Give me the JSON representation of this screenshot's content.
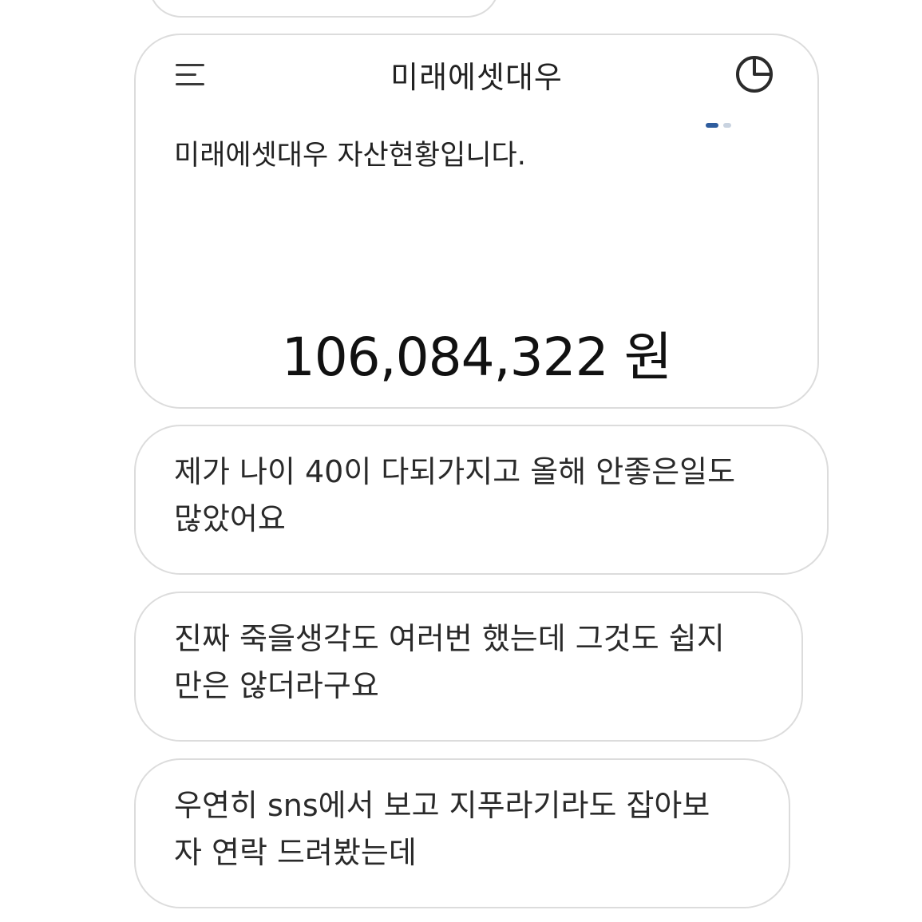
{
  "asset_card": {
    "title": "미래에셋대우",
    "subtitle": "미래에셋대우 자산현황입니다.",
    "amount": "106,084,322 원",
    "icons": [
      "menu-icon",
      "pie-chart-icon"
    ],
    "accent_color": "#2f5d9e"
  },
  "messages": [
    {
      "line1": "제가 나이 40이 다되가지고 올해 안좋은일도",
      "line2": "많았어요"
    },
    {
      "line1": "진짜 죽을생각도 여러번 했는데 그것도 쉽지",
      "line2": "만은 않더라구요"
    },
    {
      "line1": "우연히 sns에서 보고 지푸라기라도 잡아보",
      "line2": "자 연락 드려봤는데"
    }
  ]
}
